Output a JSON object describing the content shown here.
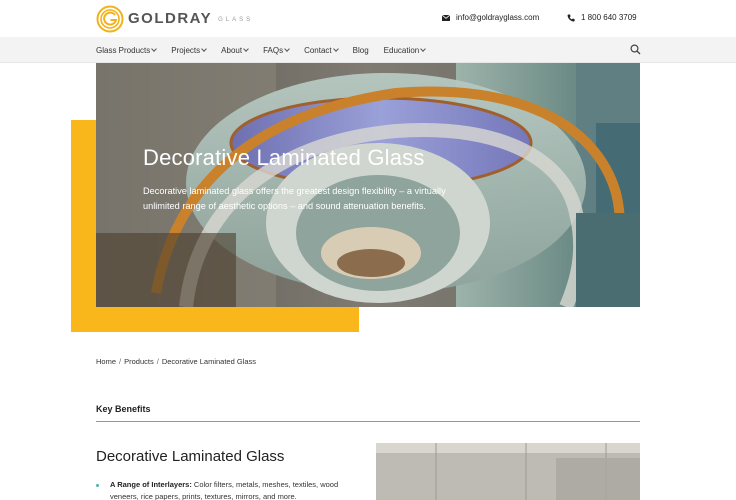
{
  "header": {
    "logo_word": "GOLDRAY",
    "logo_sub": "GLASS",
    "email": "info@goldrayglass.com",
    "phone": "1 800 640 3709"
  },
  "nav": {
    "items": [
      {
        "label": "Glass Products",
        "dropdown": true
      },
      {
        "label": "Projects",
        "dropdown": true
      },
      {
        "label": "About",
        "dropdown": true
      },
      {
        "label": "FAQs",
        "dropdown": true
      },
      {
        "label": "Contact",
        "dropdown": true
      },
      {
        "label": "Blog",
        "dropdown": false
      },
      {
        "label": "Education",
        "dropdown": true
      }
    ]
  },
  "hero": {
    "title": "Decorative Laminated Glass",
    "description": "Decorative laminated glass offers the greatest design flexibility – a virtually unlimited range of aesthetic options – and sound attenuation benefits."
  },
  "breadcrumb": {
    "home": "Home",
    "products": "Products",
    "current": "Decorative Laminated Glass",
    "separator": "/"
  },
  "key_benefits": {
    "heading": "Key Benefits"
  },
  "content": {
    "title": "Decorative Laminated Glass",
    "bullets": [
      {
        "label": "A Range of Interlayers:",
        "text": " Color filters, metals, meshes, textiles, wood veneers, rice papers, prints, textures, mirrors, and more."
      }
    ]
  },
  "colors": {
    "accent": "#f9b71b",
    "teal": "#49b8b0",
    "nav_bg": "#f3f3f3"
  }
}
